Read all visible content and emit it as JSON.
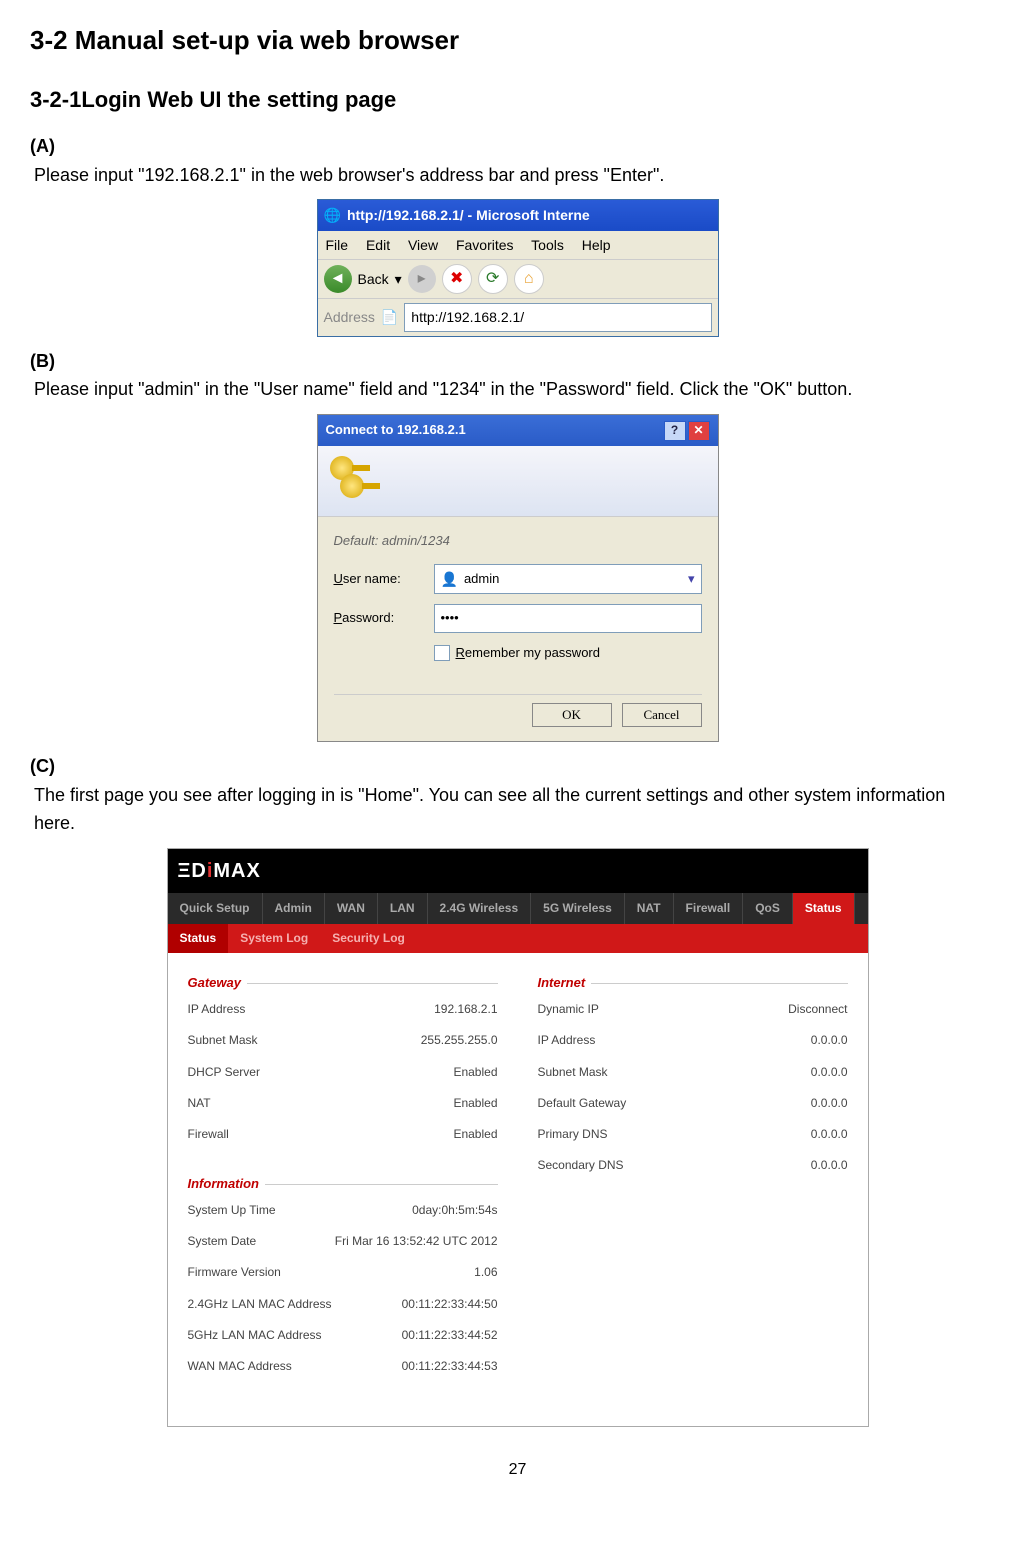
{
  "headings": {
    "h1": "3-2 Manual set-up via web browser",
    "h2": "3-2-1Login Web UI the setting page"
  },
  "steps": {
    "a_label": "(A)",
    "a_text": "Please input \"192.168.2.1\" in the web browser's address bar and press \"Enter\".",
    "b_label": "(B)",
    "b_text": "Please input \"admin\" in the \"User name\" field and \"1234\" in the \"Password\" field. Click the \"OK\" button.",
    "c_label": "(C)",
    "c_text": "The first page you see after logging in is \"Home\". You can see all the current settings and other system information here."
  },
  "ie": {
    "title": "http://192.168.2.1/ - Microsoft Interne",
    "menu": {
      "file": "File",
      "edit": "Edit",
      "view": "View",
      "favorites": "Favorites",
      "tools": "Tools",
      "help": "Help"
    },
    "toolbar": {
      "back": "Back",
      "back_arrow": "◄",
      "dot": "▾"
    },
    "addr_label": "Address",
    "addr_value": "http://192.168.2.1/"
  },
  "login": {
    "title": "Connect to 192.168.2.1",
    "default_note": "Default: admin/1234",
    "username_label": "User name:",
    "password_label": "Password:",
    "username_value": "admin",
    "password_value": "••••",
    "remember": "Remember my password",
    "ok": "OK",
    "cancel": "Cancel"
  },
  "router": {
    "logo_pre": "ΞD",
    "logo_i": "i",
    "logo_post": "MAX",
    "nav1": [
      "Quick Setup",
      "Admin",
      "WAN",
      "LAN",
      "2.4G Wireless",
      "5G Wireless",
      "NAT",
      "Firewall",
      "QoS",
      "Status"
    ],
    "nav1_active": "Status",
    "nav2": [
      "Status",
      "System Log",
      "Security Log"
    ],
    "nav2_active": "Status",
    "gateway": {
      "title": "Gateway",
      "rows": [
        {
          "k": "IP Address",
          "v": "192.168.2.1"
        },
        {
          "k": "Subnet Mask",
          "v": "255.255.255.0"
        },
        {
          "k": "DHCP Server",
          "v": "Enabled"
        },
        {
          "k": "NAT",
          "v": "Enabled"
        },
        {
          "k": "Firewall",
          "v": "Enabled"
        }
      ]
    },
    "information": {
      "title": "Information",
      "rows": [
        {
          "k": "System Up Time",
          "v": "0day:0h:5m:54s"
        },
        {
          "k": "System Date",
          "v": "Fri Mar 16 13:52:42 UTC 2012"
        },
        {
          "k": "Firmware Version",
          "v": "1.06"
        },
        {
          "k": "2.4GHz LAN MAC Address",
          "v": "00:11:22:33:44:50"
        },
        {
          "k": "5GHz LAN MAC Address",
          "v": "00:11:22:33:44:52"
        },
        {
          "k": "WAN MAC Address",
          "v": "00:11:22:33:44:53"
        }
      ]
    },
    "internet": {
      "title": "Internet",
      "rows": [
        {
          "k": "Dynamic IP",
          "v": "Disconnect"
        },
        {
          "k": "IP Address",
          "v": "0.0.0.0"
        },
        {
          "k": "Subnet Mask",
          "v": "0.0.0.0"
        },
        {
          "k": "Default Gateway",
          "v": "0.0.0.0"
        },
        {
          "k": "Primary DNS",
          "v": "0.0.0.0"
        },
        {
          "k": "Secondary DNS",
          "v": "0.0.0.0"
        }
      ]
    }
  },
  "pagenum": "27"
}
